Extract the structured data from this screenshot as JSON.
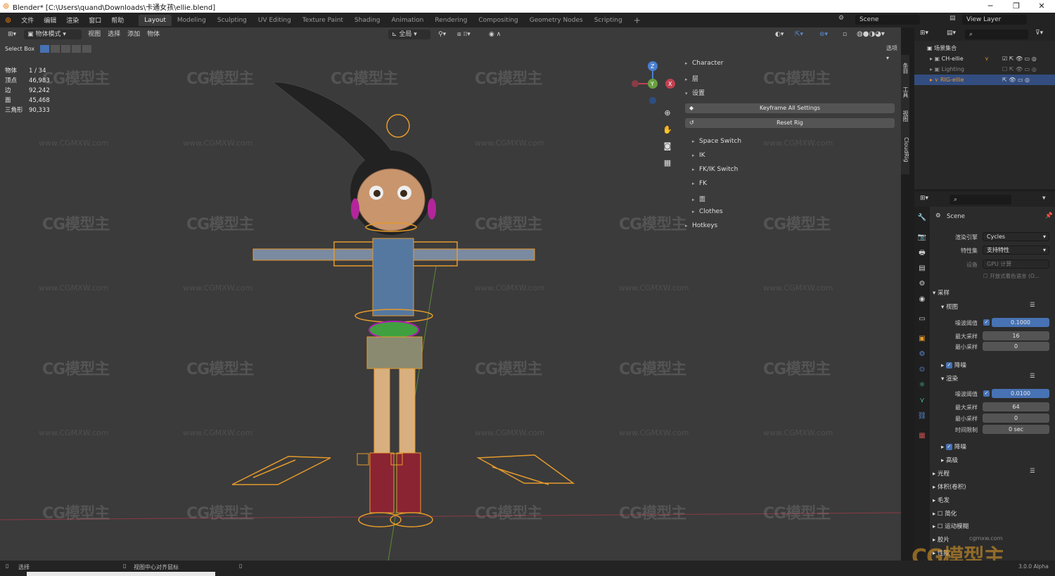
{
  "window": {
    "title": "Blender* [C:\\Users\\quand\\Downloads\\卡通女孩\\ellie.blend]",
    "min": "─",
    "max": "❐",
    "close": "✕"
  },
  "menu": [
    "文件",
    "编辑",
    "渲染",
    "窗口",
    "帮助"
  ],
  "workspaces": [
    "Layout",
    "Modeling",
    "Sculpting",
    "UV Editing",
    "Texture Paint",
    "Shading",
    "Animation",
    "Rendering",
    "Compositing",
    "Geometry Nodes",
    "Scripting"
  ],
  "active_workspace": "Layout",
  "add_workspace": "+",
  "scene": {
    "label": "Scene",
    "view_layer": "View Layer"
  },
  "viewport_header": {
    "mode": "物体模式",
    "menus": [
      "视图",
      "选择",
      "添加",
      "物体"
    ],
    "orientation": "全局",
    "options": "选项"
  },
  "select_box": "Select Box",
  "stats": [
    {
      "k": "物体",
      "v": "1 / 34"
    },
    {
      "k": "顶点",
      "v": "46,983"
    },
    {
      "k": "边",
      "v": "92,242"
    },
    {
      "k": "面",
      "v": "45,468"
    },
    {
      "k": "三角形",
      "v": "90,333"
    }
  ],
  "watermark": {
    "logo": "CG模型主",
    "url": "www.CGMXW.com",
    "corner_url": "cgmxw.com",
    "corner_logo": "CG模型主"
  },
  "npanel": {
    "top_items": [
      {
        "label": "Character",
        "arrow": "▸"
      },
      {
        "label": "层",
        "arrow": "▸"
      },
      {
        "label": "设置",
        "arrow": "▾"
      }
    ],
    "keyframe_btn": "Keyframe All Settings",
    "reset_btn": "Reset Rig",
    "sub_items": [
      "Space Switch",
      "IK",
      "FK/IK Switch",
      "FK",
      "面",
      "Clothes"
    ],
    "hotkeys": "Hotkeys",
    "tabs": [
      "条目",
      "工具",
      "视图",
      "CloudRig"
    ]
  },
  "gizmo": {
    "x": "X",
    "y": "Y",
    "z": "Z"
  },
  "outliner": {
    "collection": "场景集合",
    "items": [
      "CH-ellie",
      "Lighting",
      "RIG-ellie"
    ]
  },
  "properties": {
    "scene_name": "Scene",
    "render_engine_label": "渲染引擎",
    "render_engine": "Cycles",
    "feature_set_label": "特性集",
    "feature_set": "支持特性",
    "device_label": "设备",
    "device": "GPU 计算",
    "open_shading_lang": "开放式着色语言 (O...",
    "sampling": "采样",
    "viewport": "视图",
    "noise_threshold_label": "噪波阈值",
    "vp_noise_threshold": "0.1000",
    "max_samples_label": "最大采样",
    "vp_max_samples": "16",
    "min_samples_label": "最小采样",
    "vp_min_samples": "0",
    "denoise": "降噪",
    "render": "渲染",
    "r_noise_threshold": "0.0100",
    "r_max_samples": "64",
    "r_min_samples": "0",
    "time_limit_label": "时间限制",
    "time_limit": "0 sec",
    "denoise2": "降噪",
    "advanced": "高级",
    "sections": [
      "光程",
      "体积(卷积)",
      "毛发",
      "简化",
      "运动模糊",
      "胶片",
      "性能"
    ]
  },
  "status": {
    "select": "选择",
    "center": "视图中心对齐鼠标",
    "version": "3.0.0 Alpha"
  }
}
